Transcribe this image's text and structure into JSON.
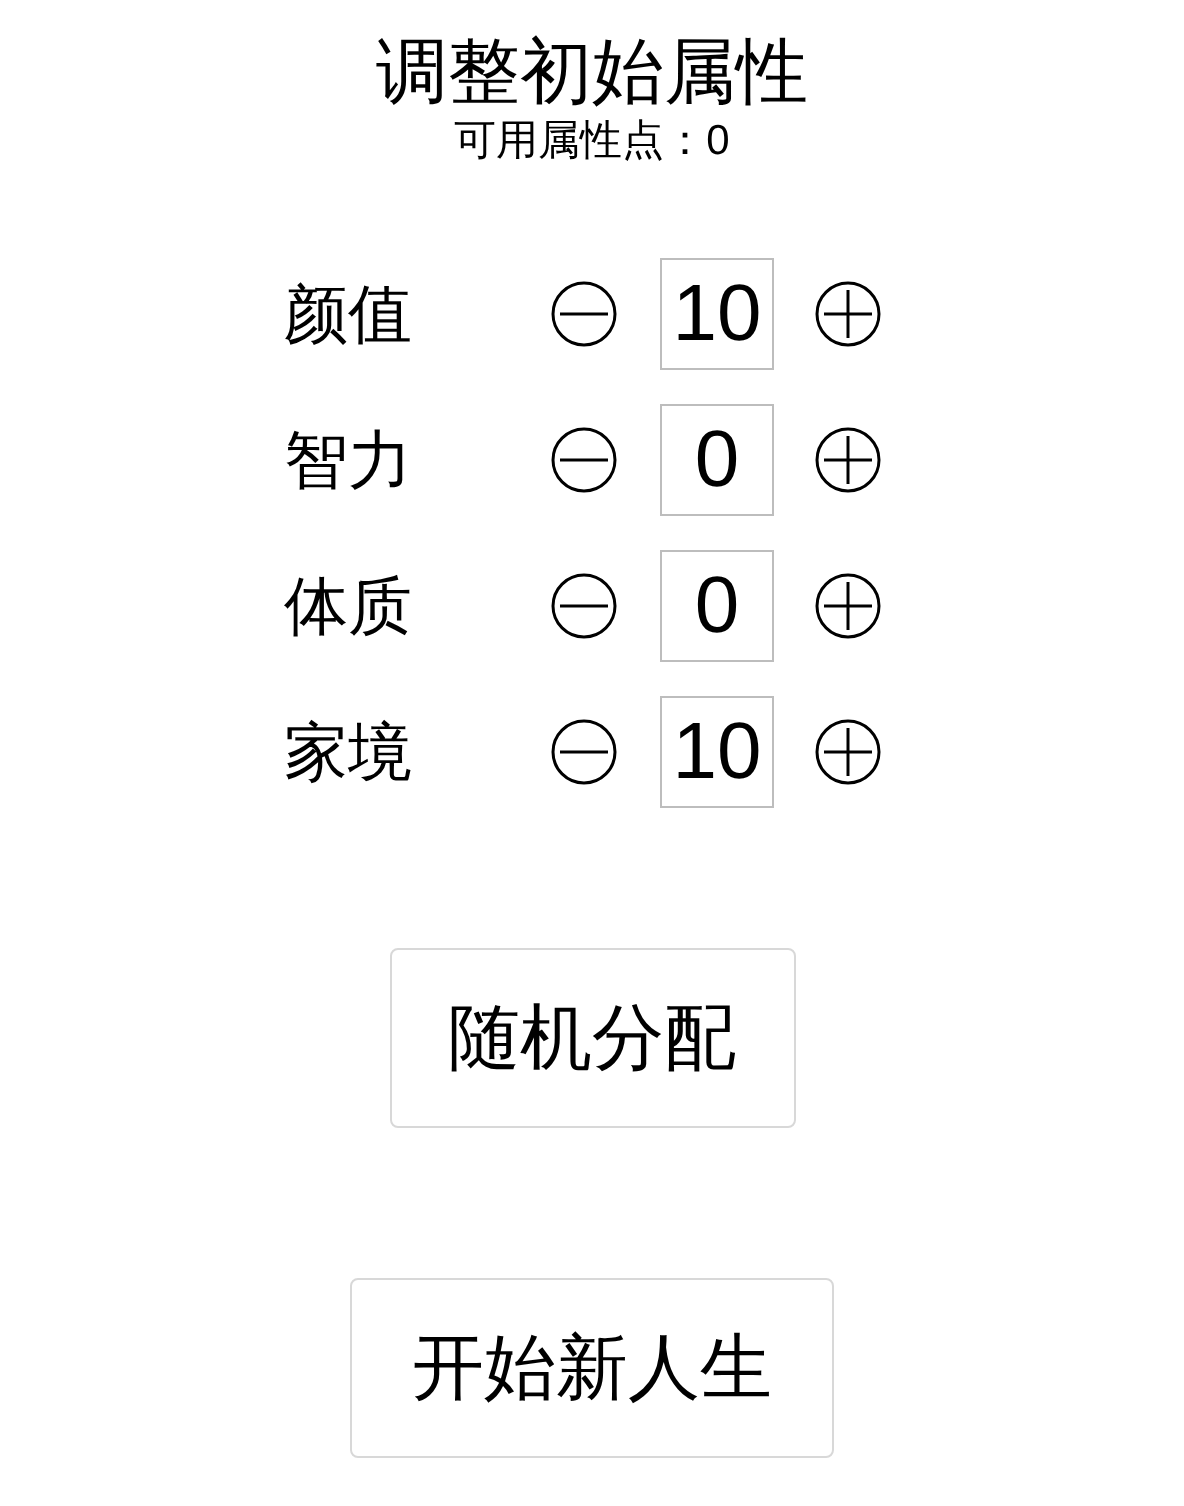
{
  "title": "调整初始属性",
  "points": {
    "label": "可用属性点：",
    "value": "0"
  },
  "attributes": [
    {
      "name": "颜值",
      "value": "10"
    },
    {
      "name": "智力",
      "value": "0"
    },
    {
      "name": "体质",
      "value": "0"
    },
    {
      "name": "家境",
      "value": "10"
    }
  ],
  "buttons": [
    {
      "label": "随机分配"
    },
    {
      "label": "开始新人生"
    }
  ]
}
